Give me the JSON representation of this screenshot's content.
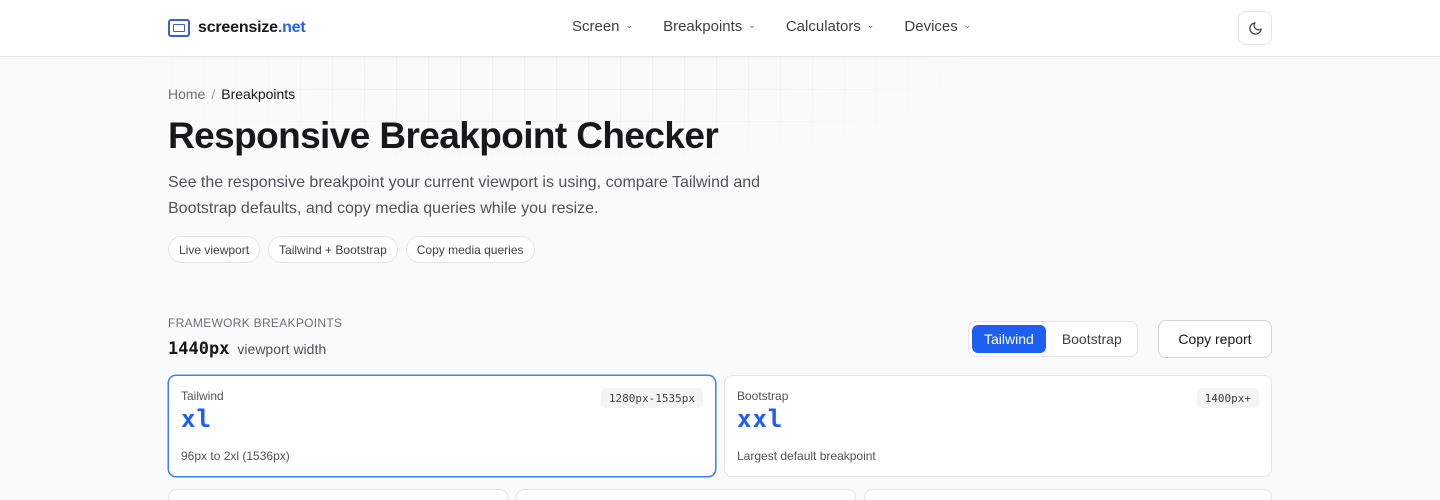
{
  "header": {
    "logo": {
      "name": "screensize",
      "tld": ".net"
    },
    "nav": [
      {
        "label": "Screen"
      },
      {
        "label": "Breakpoints"
      },
      {
        "label": "Calculators"
      },
      {
        "label": "Devices"
      }
    ],
    "theme_toggle_icon": "moon-icon"
  },
  "breadcrumb": {
    "home": "Home",
    "separator": "/",
    "current": "Breakpoints"
  },
  "hero": {
    "title": "Responsive Breakpoint Checker",
    "description": "See the responsive breakpoint your current viewport is using, compare Tailwind and Bootstrap defaults, and copy media queries while you resize.",
    "chips": [
      "Live viewport",
      "Tailwind + Bootstrap",
      "Copy media queries"
    ]
  },
  "framework": {
    "section_label": "FRAMEWORK BREAKPOINTS",
    "viewport_value": "1440px",
    "viewport_caption": "viewport width",
    "toggle": {
      "options": [
        "Tailwind",
        "Bootstrap"
      ],
      "selected": "Tailwind"
    },
    "copy_report_label": "Copy report",
    "cards": [
      {
        "framework": "Tailwind",
        "breakpoint": "xl",
        "range": "1280px-1535px",
        "note": "96px to 2xl (1536px)",
        "selected": true
      },
      {
        "framework": "Bootstrap",
        "breakpoint": "xxl",
        "range": "1400px+",
        "note": "Largest default breakpoint",
        "selected": false
      }
    ]
  },
  "colors": {
    "accent": "#1d5ff0",
    "selected_border": "#3b82f6",
    "logo_blue": "#3f5fc7"
  }
}
